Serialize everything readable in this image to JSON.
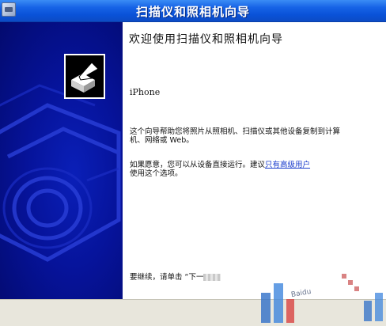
{
  "window": {
    "title": "扫描仪和照相机向导"
  },
  "wizard": {
    "heading": "欢迎使用扫描仪和照相机向导",
    "device_name": "iPhone",
    "intro_line1": "这个向导帮助您将照片从照相机、扫描仪或其他设备复制到计算",
    "intro_line2": "机、网络或 Web。",
    "advanced_line1_prefix": "如果愿意，您可以从设备直接运行。建议",
    "advanced_link": "只有高级用户",
    "advanced_line2": "使用这个选项。",
    "continue_text": "要继续，请单击 “下一"
  },
  "watermark": {
    "text": "Baidu"
  },
  "colors": {
    "titlebar": "#0a52d8",
    "panel": "#06139a",
    "link": "#1a3ccc"
  }
}
